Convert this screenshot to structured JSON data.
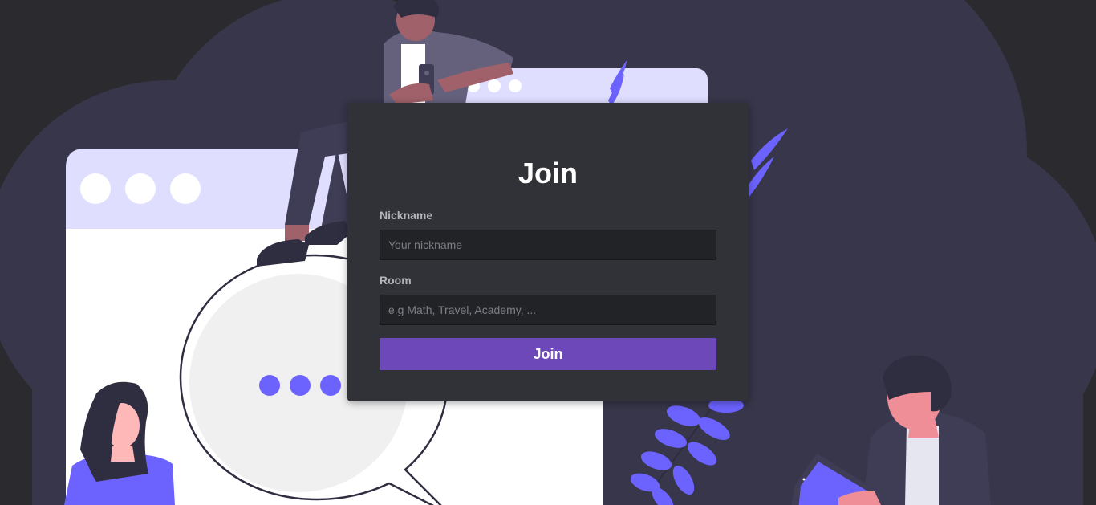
{
  "join_form": {
    "title": "Join",
    "nickname": {
      "label": "Nickname",
      "value": "",
      "placeholder": "Your nickname"
    },
    "room": {
      "label": "Room",
      "value": "",
      "placeholder": "e.g Math, Travel, Academy, ..."
    },
    "submit_label": "Join"
  },
  "colors": {
    "page_background": "#2b2b2f",
    "cloud_background": "#37364a",
    "card_background": "#313238",
    "input_background": "#222327",
    "accent_button": "#6c48b8",
    "illustration_purple": "#6c63ff",
    "window_header": "#e0deff"
  },
  "illustration": {
    "name": "chat-illustration"
  }
}
